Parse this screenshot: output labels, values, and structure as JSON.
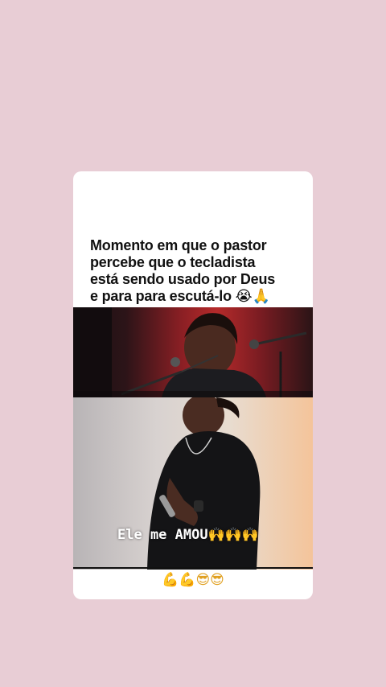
{
  "post": {
    "caption_lines": [
      "Momento em que o pastor",
      "percebe que o tecladista",
      "está sendo usado por Deus",
      "e para para escutá-lo 😭🙏"
    ],
    "overlay_text": "Ele me AMOU🙌🙌🙌",
    "emoji_caption": "💪💪😎😎"
  },
  "colors": {
    "background": "#e8cdd5",
    "card": "#ffffff",
    "stage_red": "#b52a2a"
  }
}
